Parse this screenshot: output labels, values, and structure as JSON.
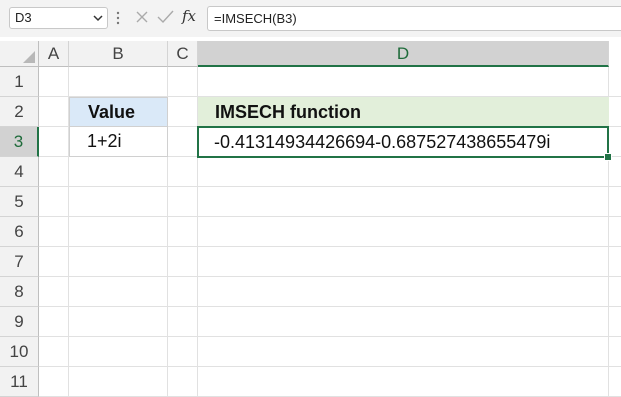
{
  "formula_bar": {
    "name_box": "D3",
    "fx_label": "fx",
    "formula": "=IMSECH(B3)"
  },
  "columns": [
    "A",
    "B",
    "C",
    "D"
  ],
  "selected_column": "D",
  "rows": [
    "1",
    "2",
    "3",
    "4",
    "5",
    "6",
    "7",
    "8",
    "9",
    "10",
    "11"
  ],
  "selected_row": "3",
  "table": {
    "header_value": "Value",
    "header_function": "IMSECH function",
    "value_b3": "1+2i",
    "result_d3": "-0.41314934426694-0.687527438655479i"
  },
  "colors": {
    "accent": "#217346",
    "value_header_fill": "#dae9f8",
    "function_header_fill": "#e2efda"
  }
}
